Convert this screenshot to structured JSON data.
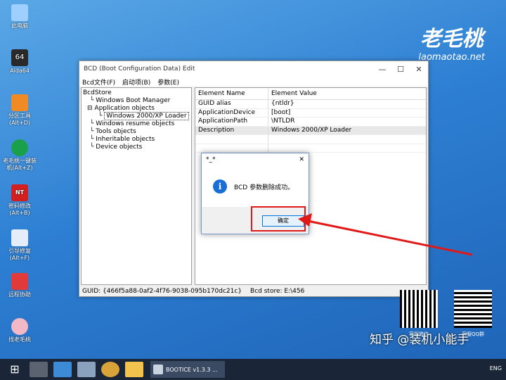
{
  "desktop": {
    "icons": [
      {
        "label": "此电脑",
        "icon": "computer-icon",
        "color": "#9ecfff"
      },
      {
        "label": "Aida64",
        "icon": "aida64-icon",
        "color": "#2a2a2a"
      },
      {
        "label": "分区工具\n(Alt+D)",
        "icon": "partition-tool-icon",
        "color": "#f08a24"
      },
      {
        "label": "老毛桃一键装\n机(Alt+Z)",
        "icon": "installer-icon",
        "color": "#1aa04a"
      },
      {
        "label": "密码修改\n(Alt+B)",
        "icon": "password-icon",
        "color": "#d22020"
      },
      {
        "label": "引导修复\n(Alt+F)",
        "icon": "boot-repair-icon",
        "color": "#e5eef8"
      },
      {
        "label": "远程协助",
        "icon": "remote-assist-icon",
        "color": "#e03a3a"
      },
      {
        "label": "找老毛桃",
        "icon": "find-laomaotao-icon",
        "color": "#f2b8c6"
      }
    ],
    "logo": {
      "brand": "老毛桃",
      "site": "laomaotao.net"
    }
  },
  "bcd_window": {
    "title": "BCD (Boot Configuration Data) Edit",
    "menu": [
      "Bcd文件(F)",
      "启动项(B)",
      "参数(E)"
    ],
    "tree": [
      "BcdStore",
      "Windows Boot Manager",
      "Application objects",
      "Windows 2000/XP Loader",
      "Windows resume objects",
      "Tools objects",
      "Inheritable objects",
      "Device objects"
    ],
    "table": {
      "headers": [
        "Element Name",
        "Element Value"
      ],
      "rows": [
        [
          "GUID alias",
          "{ntldr}"
        ],
        [
          "ApplicationDevice",
          "[boot]"
        ],
        [
          "ApplicationPath",
          "\\NTLDR"
        ],
        [
          "Description",
          "Windows 2000/XP Loader"
        ]
      ]
    },
    "status": {
      "guid": "GUID:  {466f5a88-0af2-4f76-9038-095b170dc21c}",
      "store": "Bcd store:  E:\\456"
    }
  },
  "dialog": {
    "title": "*_*",
    "message": "BCD 参数删除成功。",
    "ok_label": "确定"
  },
  "qr_codes": [
    {
      "label": "客服微信"
    },
    {
      "label": "客服QQ群"
    }
  ],
  "watermark": "知乎 @装机小能手",
  "taskbar": {
    "app_label": "BOOTICE v1.3.3 ...",
    "tray_text": "ENG"
  },
  "colors": {
    "highlight": "#e01818",
    "accent": "#0078d7"
  }
}
